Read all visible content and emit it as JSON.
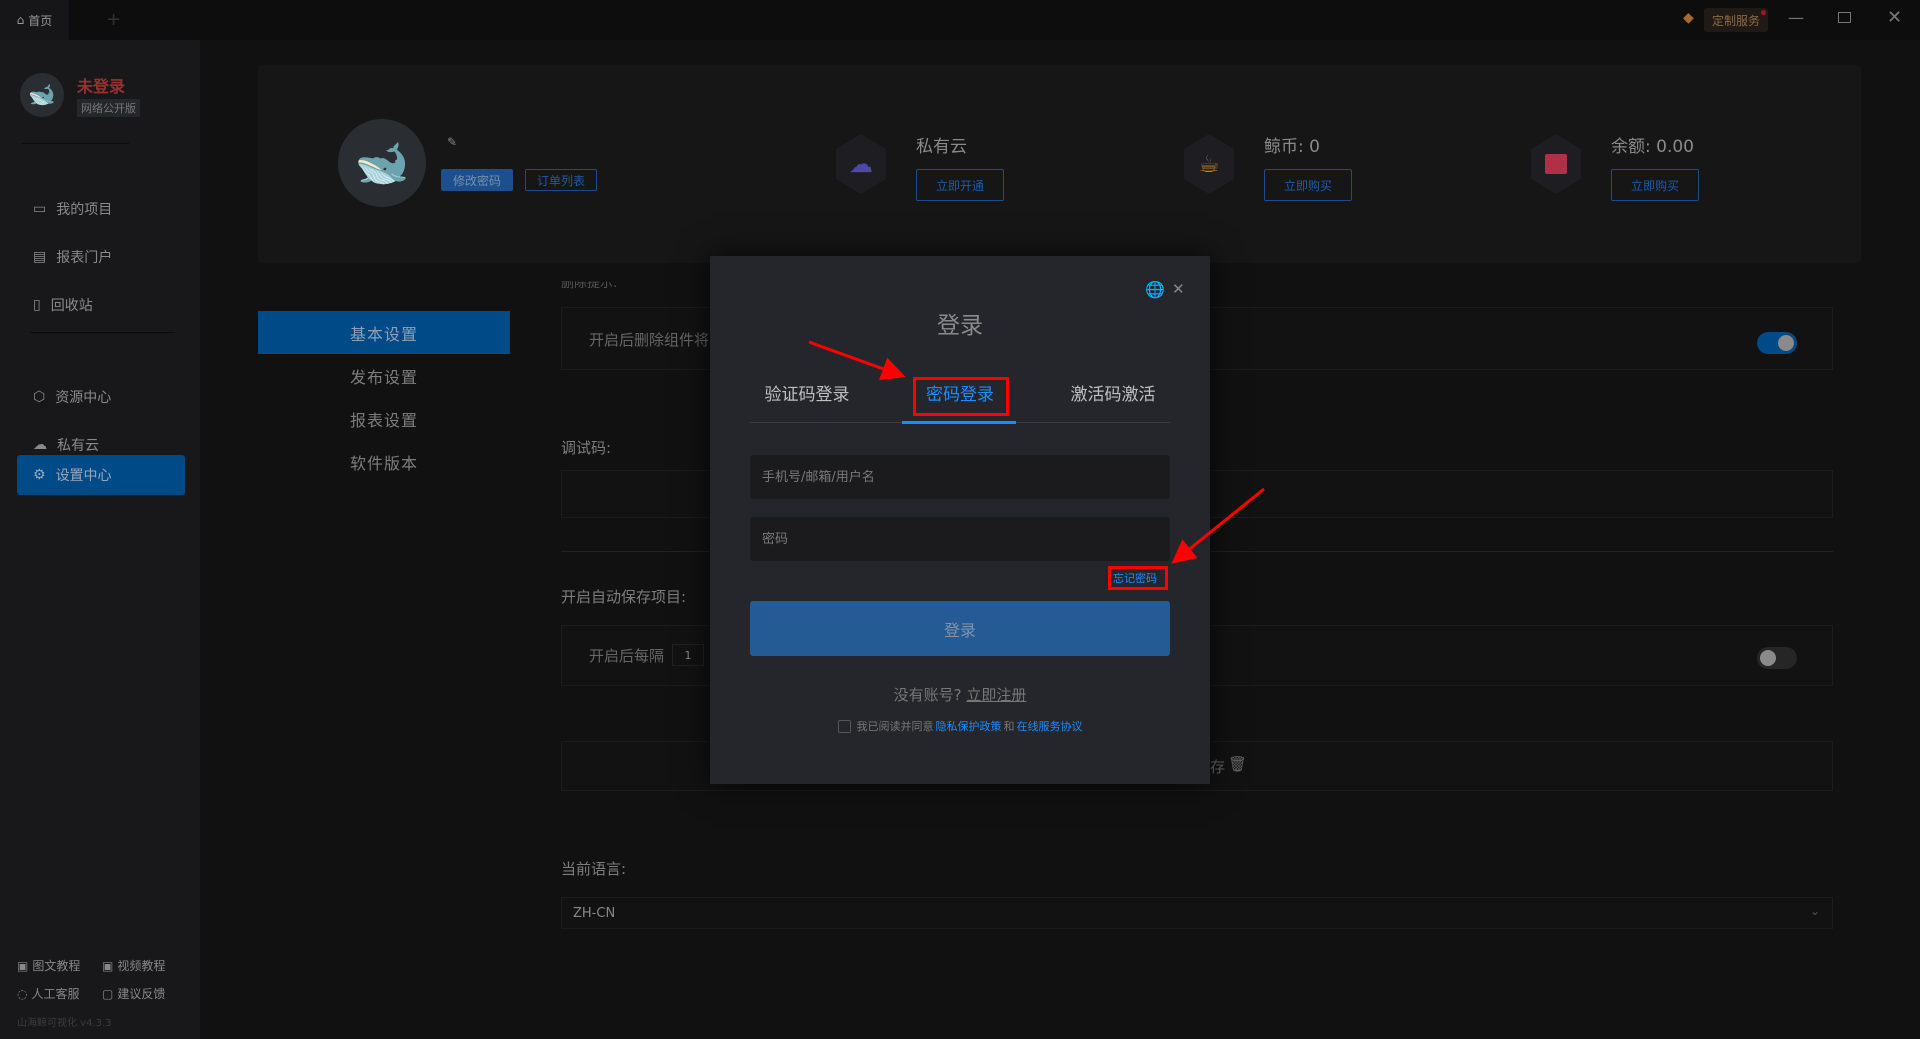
{
  "titlebar": {
    "tab_label": "首页",
    "custom_service": "定制服务",
    "icons": [
      "home-icon",
      "plus-icon",
      "diamond-icon",
      "minimize-icon",
      "restore-icon",
      "close-icon"
    ]
  },
  "sidebar": {
    "user_status": "未登录",
    "edition": "网络公开版",
    "nav_top": [
      {
        "label": "我的项目",
        "icon": "project-icon"
      },
      {
        "label": "报表门户",
        "icon": "report-icon"
      },
      {
        "label": "回收站",
        "icon": "trash-icon"
      }
    ],
    "nav_bottom": [
      {
        "label": "资源中心",
        "icon": "hexagon-icon"
      },
      {
        "label": "私有云",
        "icon": "cloud-lock-icon"
      },
      {
        "label": "设置中心",
        "icon": "gear-icon",
        "active": true
      }
    ],
    "footer": [
      {
        "label": "图文教程"
      },
      {
        "label": "视频教程"
      },
      {
        "label": "人工客服"
      },
      {
        "label": "建议反馈"
      }
    ],
    "version": "山海鲸可视化 v4.3.3"
  },
  "profile": {
    "change_password": "修改密码",
    "order_list": "订单列表",
    "stats": [
      {
        "label": "私有云",
        "button": "立即开通",
        "color": "#4a4aa8"
      },
      {
        "label": "鲸币: 0",
        "button": "立即购买",
        "color": "#c07a20"
      },
      {
        "label": "余额: 0.00",
        "button": "立即购买",
        "color": "#b03048"
      }
    ]
  },
  "settings": {
    "menu": [
      "基本设置",
      "发布设置",
      "报表设置",
      "软件版本"
    ],
    "delete_hint_label": "删除提示:",
    "delete_row_text": "开启后删除组件将",
    "debug_label": "调试码:",
    "autosave_label": "开启自动保存项目:",
    "autosave_text": "开启后每隔",
    "autosave_value": "1",
    "cache_text": "存",
    "language_label": "当前语言:",
    "language_value": "ZH-CN",
    "toggle_delete_on": true,
    "toggle_autosave_on": false
  },
  "login": {
    "title": "登录",
    "tabs": [
      "验证码登录",
      "密码登录",
      "激活码激活"
    ],
    "active_tab": 1,
    "account_placeholder": "手机号/邮箱/用户名",
    "password_placeholder": "密码",
    "forgot": "忘记密码",
    "submit": "登录",
    "no_account": "没有账号?",
    "register": "立即注册",
    "agree_prefix": "我已阅读并同意",
    "privacy": "隐私保护政策",
    "and": "和",
    "terms": "在线服务协议",
    "accent": "#1a8cff"
  },
  "annotation_color": "#ff0000"
}
